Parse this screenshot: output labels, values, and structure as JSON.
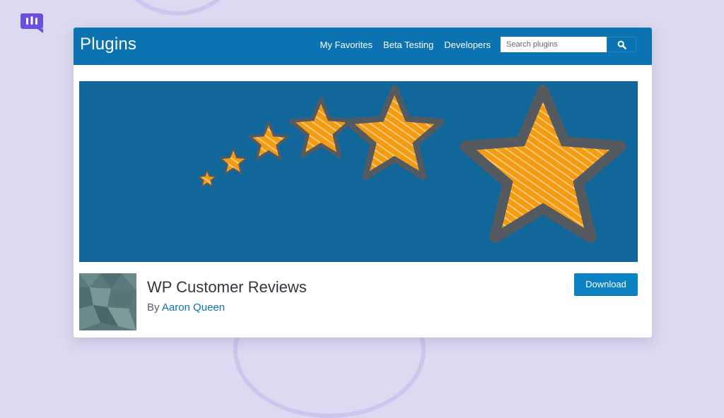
{
  "brand": {
    "icon": "speech-bubble-bars-icon",
    "accent": "#6c4ee0"
  },
  "header": {
    "title": "Plugins",
    "nav": [
      {
        "label": "My Favorites"
      },
      {
        "label": "Beta Testing"
      },
      {
        "label": "Developers"
      }
    ],
    "search": {
      "placeholder": "Search plugins",
      "button_icon": "search-icon"
    }
  },
  "banner": {
    "image": "five-hand-drawn-orange-stars-increasing-in-size",
    "background": "#12679a",
    "star_color": "#f39c12"
  },
  "plugin": {
    "name": "WP Customer Reviews",
    "author_prefix": "By",
    "author": "Aaron Queen",
    "download_label": "Download",
    "thumbnail": "geometric-pattern-thumbnail"
  }
}
